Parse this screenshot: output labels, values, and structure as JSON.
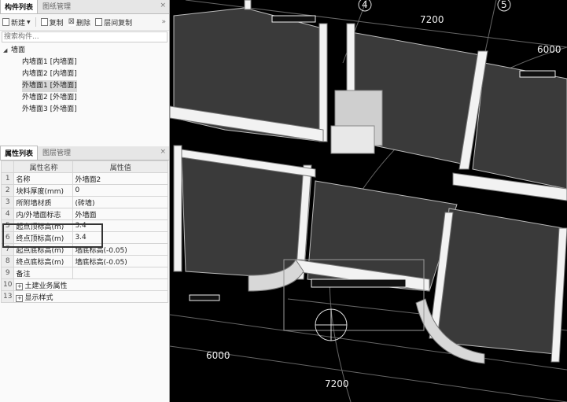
{
  "component_panel": {
    "tabs": [
      "构件列表",
      "图纸管理"
    ],
    "toolbar": {
      "new": "新建",
      "copy": "复制",
      "delete": "删除",
      "floor_copy": "层间复制"
    },
    "search_placeholder": "搜索构件...",
    "tree": {
      "root": "墙面",
      "items": [
        "内墙面1 [内墙面]",
        "内墙面2 [内墙面]",
        "外墙面1 [外墙面]",
        "外墙面2 [外墙面]",
        "外墙面3 [外墙面]"
      ]
    }
  },
  "property_panel": {
    "tabs": [
      "属性列表",
      "图层管理"
    ],
    "headers": [
      "属性名称",
      "属性值"
    ],
    "rows": [
      {
        "num": "1",
        "name": "名称",
        "value": "外墙面2"
      },
      {
        "num": "2",
        "name": "块料厚度(mm)",
        "value": "0"
      },
      {
        "num": "3",
        "name": "所附墙材质",
        "value": "(砖墙)"
      },
      {
        "num": "4",
        "name": "内/外墙面标志",
        "value": "外墙面"
      },
      {
        "num": "5",
        "name": "起点顶标高(m)",
        "value": "3.4"
      },
      {
        "num": "6",
        "name": "终点顶标高(m)",
        "value": "3.4"
      },
      {
        "num": "7",
        "name": "起点底标高(m)",
        "value": "墙底标高(-0.05)"
      },
      {
        "num": "8",
        "name": "终点底标高(m)",
        "value": "墙底标高(-0.05)"
      },
      {
        "num": "9",
        "name": "备注",
        "value": ""
      },
      {
        "num": "10",
        "name": "土建业务属性",
        "value": ""
      },
      {
        "num": "13",
        "name": "显示样式",
        "value": ""
      }
    ]
  },
  "viewport": {
    "axis_markers": [
      "4",
      "5"
    ],
    "dimensions": [
      "7200",
      "6000",
      "6000",
      "7200"
    ]
  }
}
